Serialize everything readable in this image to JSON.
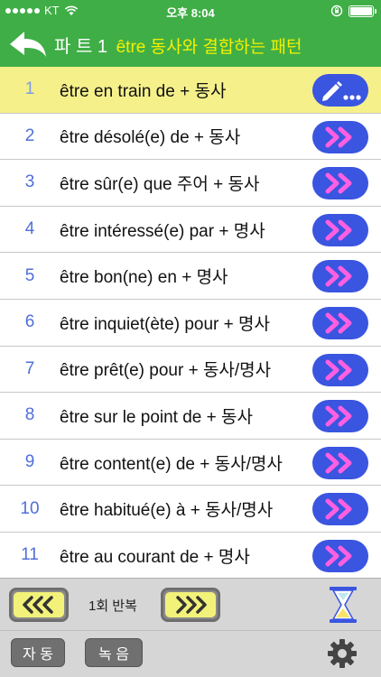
{
  "status_bar": {
    "carrier": "KT",
    "time": "오후 8:04"
  },
  "header": {
    "title_prefix": "파 트 1",
    "title_main": "être 동사와 결합하는 패턴"
  },
  "items": [
    {
      "num": "1",
      "text": "être en train de + 동사"
    },
    {
      "num": "2",
      "text": "être désolé(e) de + 동사"
    },
    {
      "num": "3",
      "text": "être sûr(e) que 주어 + 동사"
    },
    {
      "num": "4",
      "text": "être intéressé(e) par + 명사"
    },
    {
      "num": "5",
      "text": "être bon(ne) en + 명사"
    },
    {
      "num": "6",
      "text": "être inquiet(ète) pour + 명사"
    },
    {
      "num": "7",
      "text": "être prêt(e) pour + 동사/명사"
    },
    {
      "num": "8",
      "text": "être sur le point de + 동사"
    },
    {
      "num": "9",
      "text": "être content(e) de + 동사/명사"
    },
    {
      "num": "10",
      "text": "être habitué(e) à + 동사/명사"
    },
    {
      "num": "11",
      "text": "être au courant de + 명사"
    }
  ],
  "toolbar": {
    "repeat_label": "1회 반복"
  },
  "footer": {
    "auto_label": "자 동",
    "record_label": "녹 음"
  },
  "colors": {
    "header_green": "#3fae46",
    "active_row": "#f5f08a",
    "play_button": "#3a55e0",
    "chevron_pink": "#ff5fe0",
    "title_yellow": "#f4f000"
  }
}
